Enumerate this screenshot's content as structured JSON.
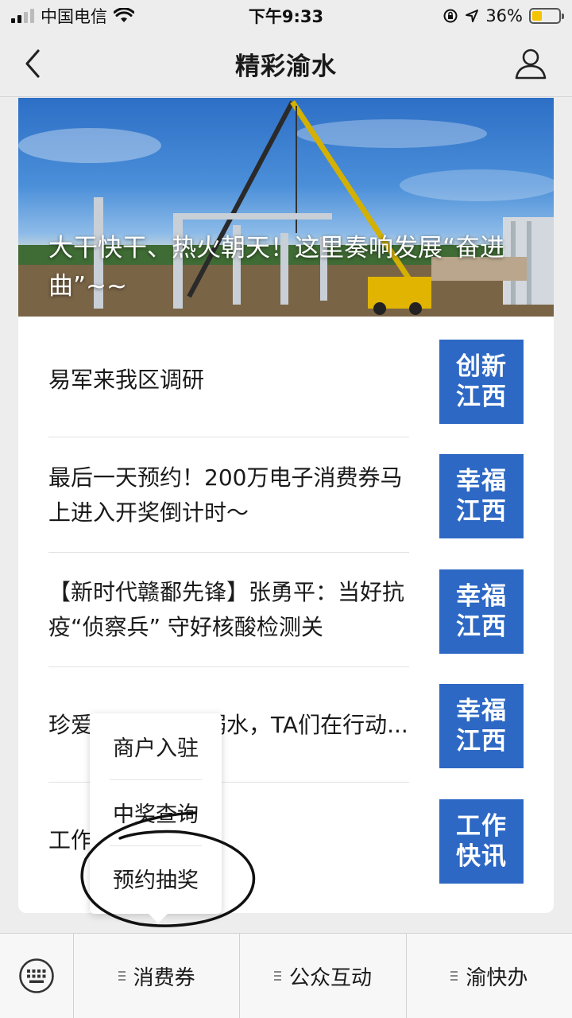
{
  "status_bar": {
    "carrier": "中国电信",
    "time": "下午9:33",
    "battery_percent": "36%",
    "battery_level": 0.36
  },
  "nav": {
    "title": "精彩渝水",
    "back_icon": "chevron-left-icon",
    "user_icon": "user-icon"
  },
  "banner": {
    "title": "大干快干、热火朝天！这里奏响发展“奋进曲”~~"
  },
  "news": [
    {
      "text": "易军来我区调研",
      "badge_line1": "创新",
      "badge_line2": "江西"
    },
    {
      "text": "最后一天预约！200万电子消费券马上进入开奖倒计时～",
      "badge_line1": "幸福",
      "badge_line2": "江西"
    },
    {
      "text": "【新时代赣鄱先锋】张勇平：当好抗疫“侦察兵” 守好核酸检测关",
      "badge_line1": "幸福",
      "badge_line2": "江西"
    },
    {
      "text": "珍爱生命，预防溺水，TA们在行动...",
      "badge_line1": "幸福",
      "badge_line2": "江西"
    },
    {
      "text": "工作",
      "badge_line1": "工作",
      "badge_line2": "快讯"
    }
  ],
  "popup_menu": {
    "items": [
      "商户入驻",
      "中奖查询",
      "预约抽奖"
    ]
  },
  "bottom_menu": {
    "keyboard_icon": "keyboard-icon",
    "items": [
      "消费券",
      "公众互动",
      "渝快办"
    ]
  },
  "colors": {
    "badge_blue": "#2d68c4",
    "background": "#ededed"
  }
}
